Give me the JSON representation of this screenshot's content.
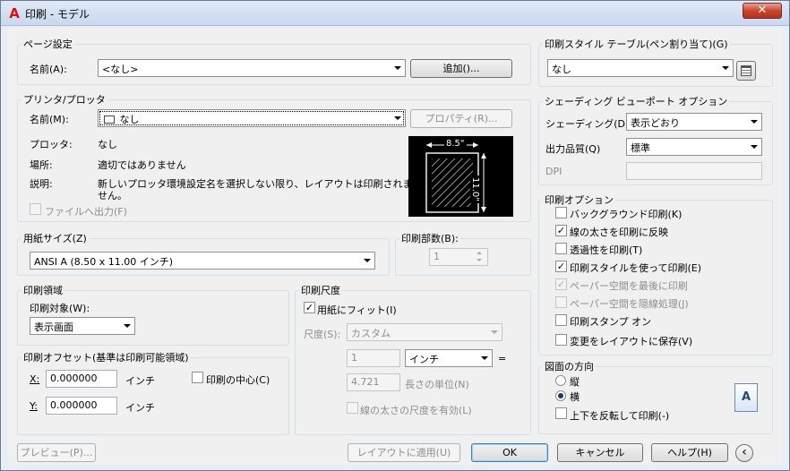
{
  "window": {
    "title": "印刷 - モデル",
    "close_label": "✕",
    "app_icon": "A"
  },
  "page_setup": {
    "legend": "ページ設定",
    "name_label": "名前(A):",
    "name_value": "<なし>",
    "add_button": "追加()..."
  },
  "printer": {
    "legend": "プリンタ/プロッタ",
    "name_label": "名前(M):",
    "name_value": "なし",
    "properties_button": "プロパティ(R)...",
    "plotter_label": "プロッタ:",
    "plotter_value": "なし",
    "where_label": "場所:",
    "where_value": "適切ではありません",
    "desc_label": "説明:",
    "desc_value_line1": "新しいプロッタ環境設定名を選択しない限り、レイアウトは印刷されま",
    "desc_value_line2": "せん。",
    "print_to_file": "ファイルへ出力(F)",
    "preview_width": "8.5\"",
    "preview_height": "11.0\""
  },
  "paper_size": {
    "legend": "用紙サイズ(Z)",
    "value": "ANSI A (8.50 x 11.00 インチ)"
  },
  "copies": {
    "legend": "印刷部数(B):",
    "value": "1"
  },
  "plot_area": {
    "legend": "印刷領域",
    "what_label": "印刷対象(W):",
    "what_value": "表示画面"
  },
  "plot_offset": {
    "legend": "印刷オフセット(基準は印刷可能領域)",
    "x_label": "X:",
    "x_value": "0.000000",
    "x_unit": "インチ",
    "y_label": "Y:",
    "y_value": "0.000000",
    "y_unit": "インチ",
    "center_label": "印刷の中心(C)"
  },
  "plot_scale": {
    "legend": "印刷尺度",
    "fit_label": "用紙にフィット(I)",
    "scale_label": "尺度(S):",
    "scale_value": "カスタム",
    "num_value": "1",
    "unit_value": "インチ",
    "equals": "=",
    "den_value": "4.721",
    "den_unit": "長さの単位(N)",
    "lineweights_label": "線の太さの尺度を有効(L)"
  },
  "style_table": {
    "legend": "印刷スタイル テーブル(ペン割り当て)(G)",
    "value": "なし"
  },
  "shaded": {
    "legend": "シェーディング ビューポート オプション",
    "shade_label": "シェーディング(D)",
    "shade_value": "表示どおり",
    "quality_label": "出力品質(Q)",
    "quality_value": "標準",
    "dpi_label": "DPI"
  },
  "plot_options": {
    "legend": "印刷オプション",
    "items": [
      {
        "label": "バックグラウンド印刷(K)",
        "checked": ""
      },
      {
        "label": "線の太さを印刷に反映",
        "checked": "✓"
      },
      {
        "label": "透過性を印刷(T)",
        "checked": ""
      },
      {
        "label": "印刷スタイルを使って印刷(E)",
        "checked": "✓"
      },
      {
        "label": "ペーパー空間を最後に印刷",
        "checked": "✓"
      },
      {
        "label": "ペーパー空間を隠線処理(J)",
        "checked": ""
      },
      {
        "label": "印刷スタンプ オン",
        "checked": ""
      },
      {
        "label": "変更をレイアウトに保存(V)",
        "checked": ""
      }
    ]
  },
  "orientation": {
    "legend": "図面の方向",
    "portrait": "縦",
    "landscape": "横",
    "upside_down": "上下を反転して印刷(-)",
    "icon_letter": "A"
  },
  "footer": {
    "preview": "プレビュー(P)...",
    "apply": "レイアウトに適用(U)",
    "ok": "OK",
    "cancel": "キャンセル",
    "help": "ヘルプ(H)",
    "collapse": "‹"
  },
  "colors": {
    "accent": "#3c7fb1",
    "close": "#c9452f",
    "window_bg": "#f0f0f0"
  }
}
